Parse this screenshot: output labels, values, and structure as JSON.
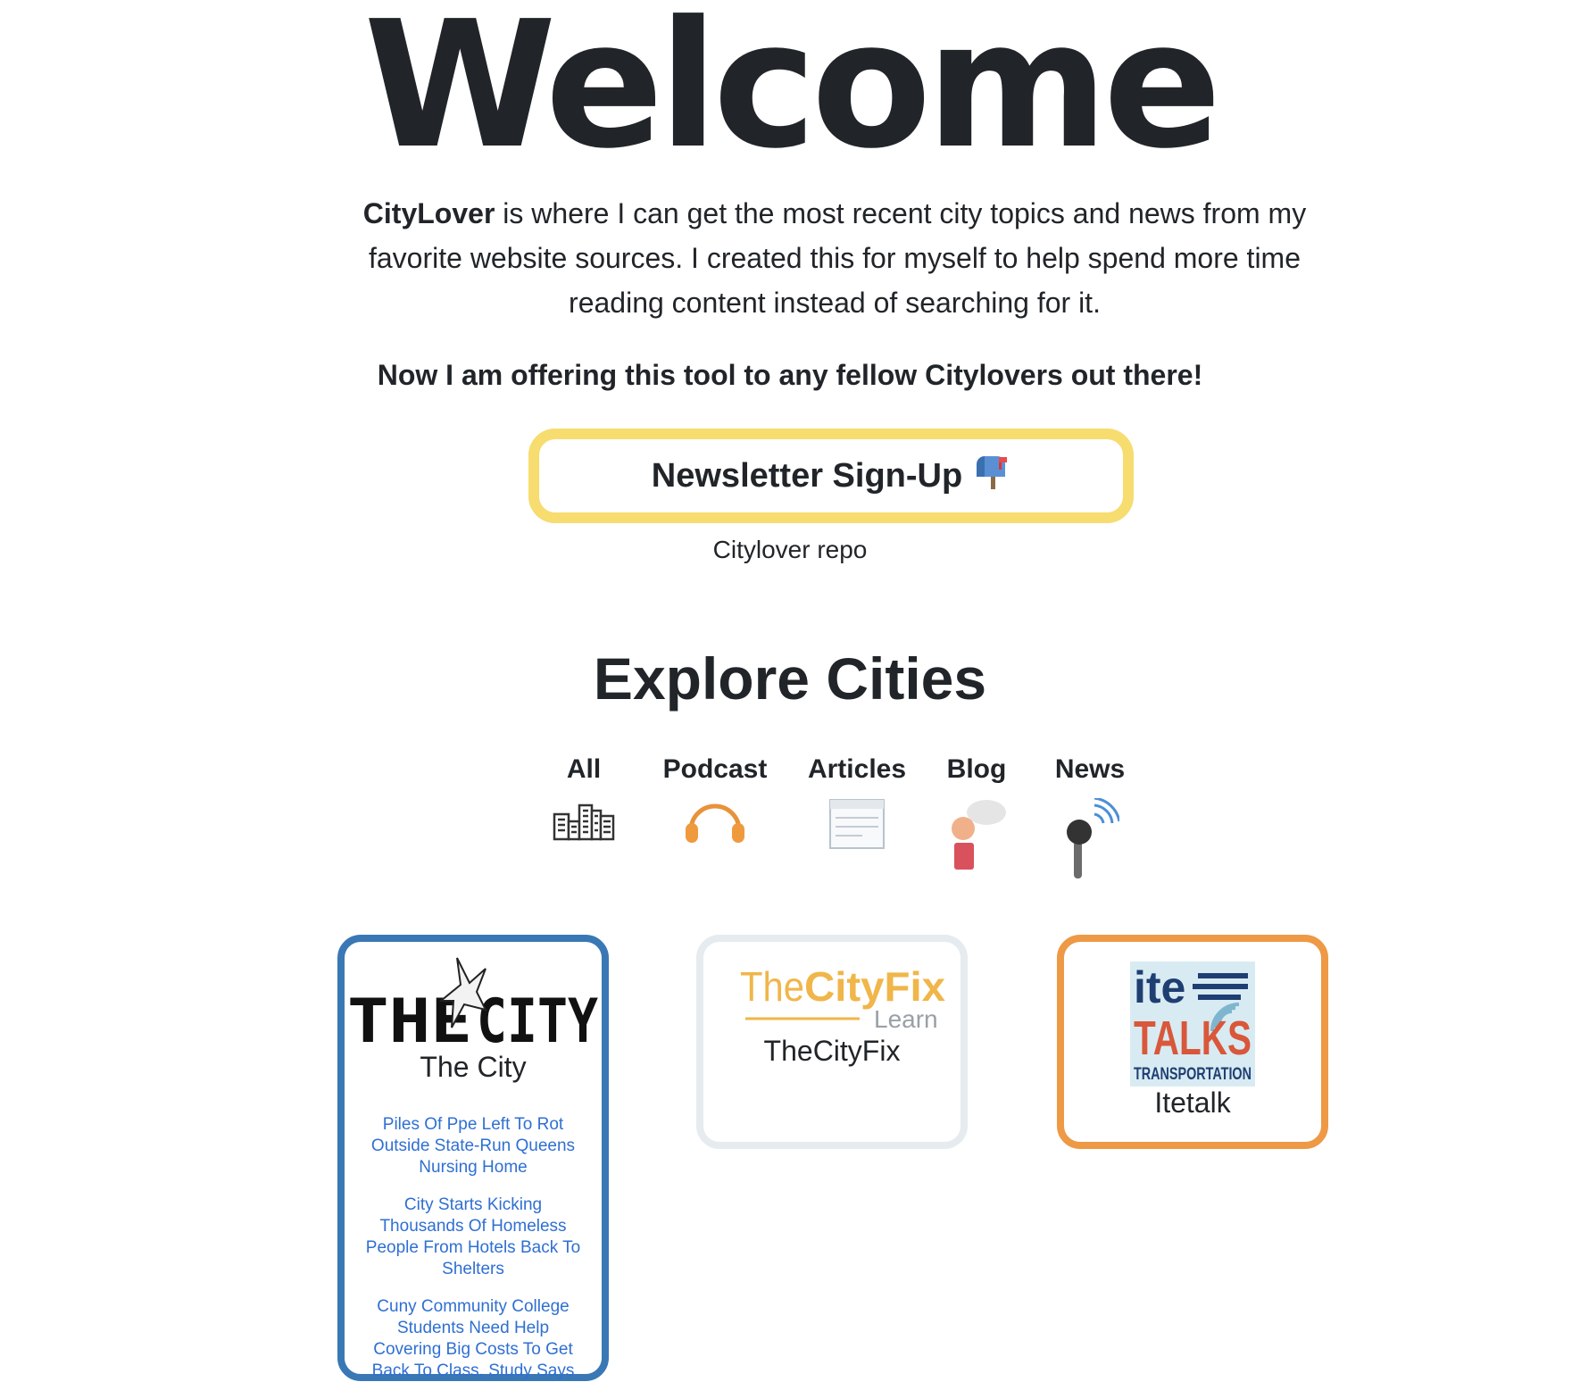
{
  "hero": {
    "title": "Welcome",
    "brand": "CityLover",
    "intro_rest": " is where I can get the most recent city topics and news from my favorite website sources. I created this for myself to help spend more time reading content instead of searching for it.",
    "offer": "Now I am offering this tool to any fellow Citylovers out there!",
    "newsletter_label": "Newsletter Sign-Up",
    "newsletter_icon": "mailbox-icon",
    "repo_link": "Citylover repo"
  },
  "explore": {
    "title": "Explore Cities",
    "filters": [
      {
        "label": "All",
        "icon": "city-buildings-icon"
      },
      {
        "label": "Podcast",
        "icon": "headphones-icon"
      },
      {
        "label": "Articles",
        "icon": "newspaper-icon"
      },
      {
        "label": "Blog",
        "icon": "speech-person-icon"
      },
      {
        "label": "News",
        "icon": "microphone-icon"
      }
    ]
  },
  "sources": [
    {
      "name": "The City",
      "logo_text": [
        "THE",
        "CITY"
      ],
      "border_color": "#3a78b5",
      "articles": [
        "Piles Of Ppe Left To Rot Outside State-Run Queens Nursing Home",
        "City Starts Kicking Thousands Of Homeless People From Hotels Back To Shelters",
        "Cuny Community College Students Need Help Covering Big Costs To Get Back To Class, Study Says"
      ]
    },
    {
      "name": "TheCityFix",
      "logo_text": [
        "The",
        "CityFix",
        "Learn"
      ],
      "border_color": "#e6ebef",
      "articles": []
    },
    {
      "name": "Itetalk",
      "logo_text": [
        "ite",
        "TALKS",
        "TRANSPORTATION"
      ],
      "border_color": "#ee9945",
      "articles": []
    }
  ],
  "colors": {
    "newsletter_border": "#f7dc6f",
    "link": "#2f6fd2",
    "text": "#212529"
  }
}
